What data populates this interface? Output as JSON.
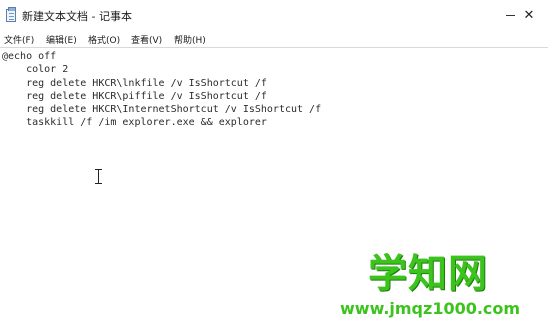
{
  "window": {
    "title": "新建文本文档 - 记事本",
    "minimize_glyph": "—",
    "close_glyph": "✕",
    "app_icon": "notepad-icon"
  },
  "menubar": {
    "file": "文件(F)",
    "edit": "编辑(E)",
    "format": "格式(O)",
    "view": "查看(V)",
    "help": "帮助(H)"
  },
  "editor": {
    "content": "@echo off\n    color 2\n    reg delete HKCR\\lnkfile /v IsShortcut /f\n    reg delete HKCR\\piffile /v IsShortcut /f\n    reg delete HKCR\\InternetShortcut /v IsShortcut /f\n    taskkill /f /im explorer.exe && explorer",
    "cursor_icon": "text-ibeam-cursor"
  },
  "watermark": {
    "name": "学知网",
    "url": "www.jmqz1000.com",
    "color": "#3cc31e"
  }
}
